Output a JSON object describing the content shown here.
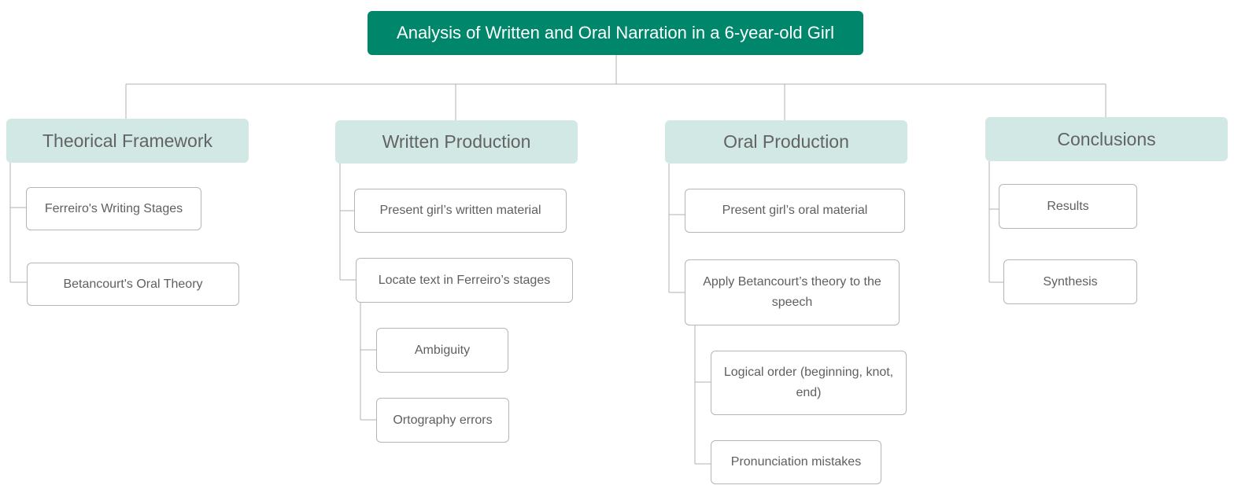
{
  "diagram": {
    "title": "Analysis of Written and Oral Narration in a 6-year-old Girl",
    "colors": {
      "root_fill": "#00866a",
      "branch_fill": "#d2e8e4",
      "leaf_border": "#b5b5b5",
      "connector": "#b0b0b0"
    },
    "branches": [
      {
        "label": "Theorical Framework",
        "children": [
          {
            "label": "Ferreiro's Writing Stages",
            "children": []
          },
          {
            "label": "Betancourt's Oral Theory",
            "children": []
          }
        ]
      },
      {
        "label": "Written Production",
        "children": [
          {
            "label": "Present girl’s written material",
            "children": []
          },
          {
            "label": "Locate text in Ferreiro’s stages",
            "children": [
              {
                "label": "Ambiguity"
              },
              {
                "label": "Ortography errors"
              }
            ]
          }
        ]
      },
      {
        "label": "Oral Production",
        "children": [
          {
            "label": "Present girl’s oral material",
            "children": []
          },
          {
            "label": "Apply Betancourt’s theory to the speech",
            "children": [
              {
                "label": "Logical order (beginning, knot, end)"
              },
              {
                "label": "Pronunciation mistakes"
              }
            ]
          }
        ]
      },
      {
        "label": "Conclusions",
        "children": [
          {
            "label": "Results",
            "children": []
          },
          {
            "label": "Synthesis",
            "children": []
          }
        ]
      }
    ]
  }
}
